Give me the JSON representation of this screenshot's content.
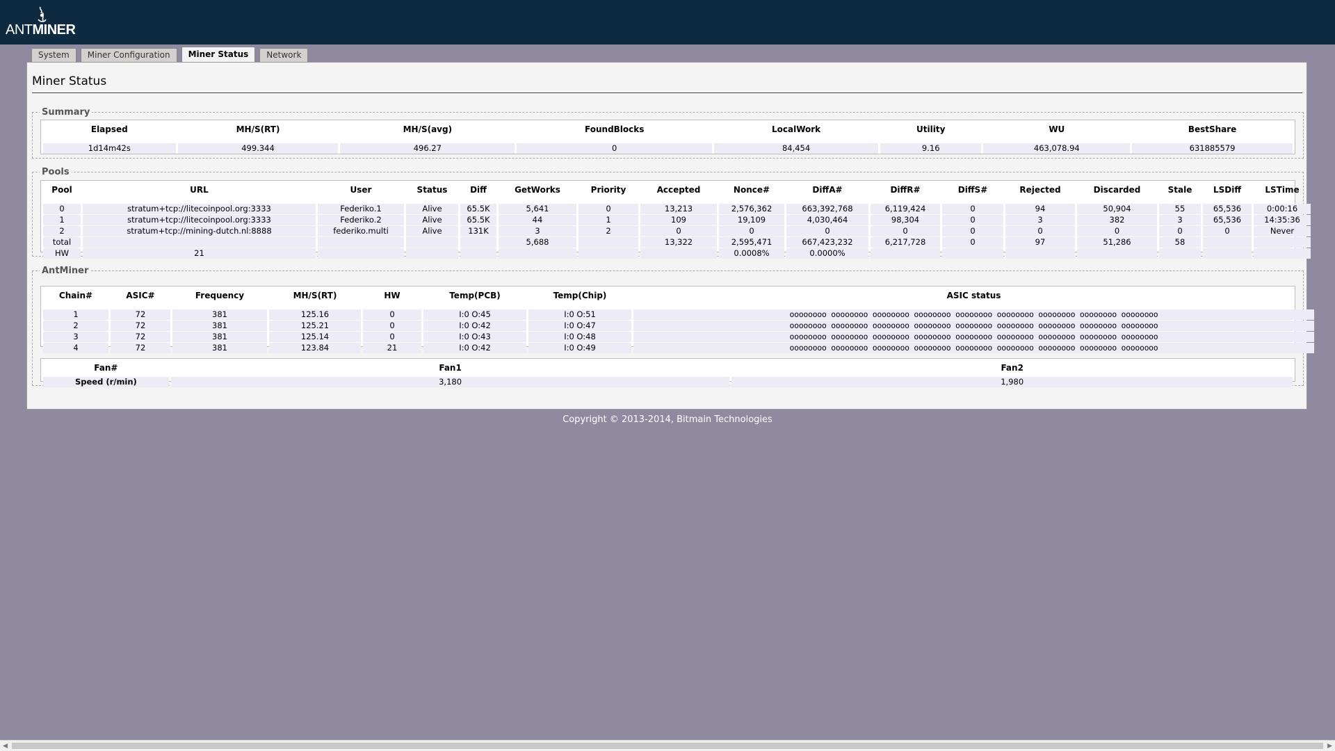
{
  "brand": {
    "light": "ANT",
    "bold": "MINER"
  },
  "tabs": [
    {
      "label": "System",
      "active": false
    },
    {
      "label": "Miner Configuration",
      "active": false
    },
    {
      "label": "Miner Status",
      "active": true
    },
    {
      "label": "Network",
      "active": false
    }
  ],
  "page_title": "Miner Status",
  "summary": {
    "legend": "Summary",
    "headers": [
      "Elapsed",
      "MH/S(RT)",
      "MH/S(avg)",
      "FoundBlocks",
      "LocalWork",
      "Utility",
      "WU",
      "BestShare"
    ],
    "values": [
      "1d14m42s",
      "499.344",
      "496.27",
      "0",
      "84,454",
      "9.16",
      "463,078.94",
      "631885579"
    ]
  },
  "pools": {
    "legend": "Pools",
    "headers": [
      "Pool",
      "URL",
      "User",
      "Status",
      "Diff",
      "GetWorks",
      "Priority",
      "Accepted",
      "Nonce#",
      "DiffA#",
      "DiffR#",
      "DiffS#",
      "Rejected",
      "Discarded",
      "Stale",
      "LSDiff",
      "LSTime"
    ],
    "rows": [
      [
        "0",
        "stratum+tcp://litecoinpool.org:3333",
        "Federiko.1",
        "Alive",
        "65.5K",
        "5,641",
        "0",
        "13,213",
        "2,576,362",
        "663,392,768",
        "6,119,424",
        "0",
        "94",
        "50,904",
        "55",
        "65,536",
        "0:00:16"
      ],
      [
        "1",
        "stratum+tcp://litecoinpool.org:3333",
        "Federiko.2",
        "Alive",
        "65.5K",
        "44",
        "1",
        "109",
        "19,109",
        "4,030,464",
        "98,304",
        "0",
        "3",
        "382",
        "3",
        "65,536",
        "14:35:36"
      ],
      [
        "2",
        "stratum+tcp://mining-dutch.nl:8888",
        "federiko.multi",
        "Alive",
        "131K",
        "3",
        "2",
        "0",
        "0",
        "0",
        "0",
        "0",
        "0",
        "0",
        "0",
        "0",
        "Never"
      ],
      [
        "total",
        "",
        "",
        "",
        "",
        "5,688",
        "",
        "13,322",
        "2,595,471",
        "667,423,232",
        "6,217,728",
        "0",
        "97",
        "51,286",
        "58",
        "",
        ""
      ],
      [
        "HW",
        "21",
        "",
        "",
        "",
        "",
        "",
        "",
        "0.0008%",
        "0.0000%",
        "",
        "",
        "",
        "",
        "",
        "",
        ""
      ]
    ]
  },
  "antminer": {
    "legend": "AntMiner",
    "headers": [
      "Chain#",
      "ASIC#",
      "Frequency",
      "MH/S(RT)",
      "HW",
      "Temp(PCB)",
      "Temp(Chip)",
      "ASIC status"
    ],
    "rows": [
      [
        "1",
        "72",
        "381",
        "125.16",
        "0",
        "I:0 O:45",
        "I:0 O:51",
        "oooooooo oooooooo oooooooo oooooooo oooooooo oooooooo oooooooo oooooooo oooooooo"
      ],
      [
        "2",
        "72",
        "381",
        "125.21",
        "0",
        "I:0 O:42",
        "I:0 O:47",
        "oooooooo oooooooo oooooooo oooooooo oooooooo oooooooo oooooooo oooooooo oooooooo"
      ],
      [
        "3",
        "72",
        "381",
        "125.14",
        "0",
        "I:0 O:43",
        "I:0 O:48",
        "oooooooo oooooooo oooooooo oooooooo oooooooo oooooooo oooooooo oooooooo oooooooo"
      ],
      [
        "4",
        "72",
        "381",
        "123.84",
        "21",
        "I:0 O:42",
        "I:0 O:49",
        "oooooooo oooooooo oooooooo oooooooo oooooooo oooooooo oooooooo oooooooo oooooooo"
      ]
    ],
    "fans": {
      "headers": [
        "Fan#",
        "Fan1",
        "Fan2"
      ],
      "speed_label": "Speed (r/min)",
      "speeds": [
        "3,180",
        "1,980"
      ]
    }
  },
  "copyright": "Copyright © 2013-2014, Bitmain Technologies"
}
